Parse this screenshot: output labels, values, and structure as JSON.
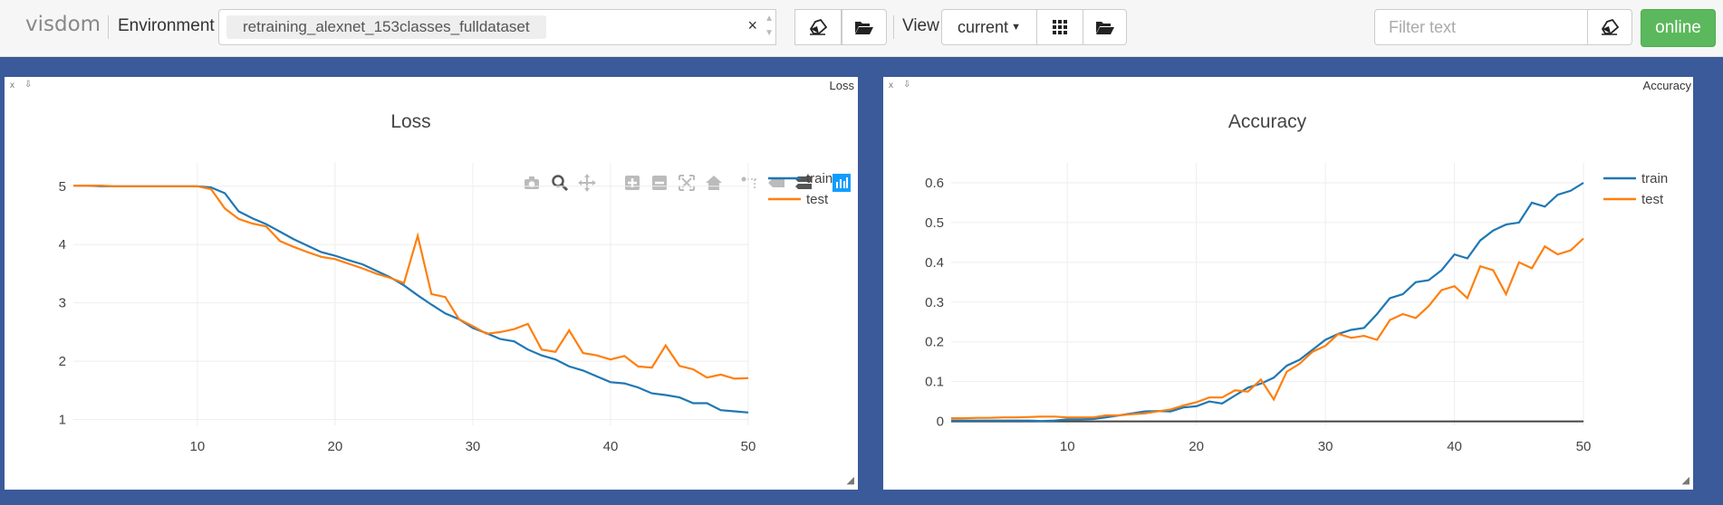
{
  "app": {
    "title": "visdom"
  },
  "env": {
    "label": "Environment",
    "selected": "retraining_alexnet_153classes_fulldataset"
  },
  "view": {
    "label": "View",
    "selected": "current"
  },
  "filter": {
    "placeholder": "Filter text"
  },
  "status": {
    "label": "online"
  },
  "colors": {
    "train": "#1f77b4",
    "test": "#ff7f0e",
    "online": "#5cb85c",
    "background": "#3b5a9a"
  },
  "panes": [
    {
      "name": "Loss",
      "title": "Loss"
    },
    {
      "name": "Accuracy",
      "title": "Accuracy"
    }
  ],
  "chart_data": [
    {
      "type": "line",
      "title": "Loss",
      "xlim": [
        1,
        50
      ],
      "ylim": [
        0.9,
        5.4
      ],
      "x_ticks": [
        10,
        20,
        30,
        40,
        50
      ],
      "y_ticks": [
        1,
        2,
        3,
        4,
        5
      ],
      "legend_position": "right",
      "grid": true,
      "x": [
        1,
        2,
        3,
        4,
        5,
        6,
        7,
        8,
        9,
        10,
        11,
        12,
        13,
        14,
        15,
        16,
        17,
        18,
        19,
        20,
        21,
        22,
        23,
        24,
        25,
        26,
        27,
        28,
        29,
        30,
        31,
        32,
        33,
        34,
        35,
        36,
        37,
        38,
        39,
        40,
        41,
        42,
        43,
        44,
        45,
        46,
        47,
        48,
        49,
        50
      ],
      "series": [
        {
          "name": "train",
          "values": [
            5.01,
            5.01,
            5.0,
            5.0,
            5.0,
            5.0,
            5.0,
            5.0,
            5.0,
            5.0,
            4.98,
            4.88,
            4.57,
            4.45,
            4.35,
            4.22,
            4.09,
            3.98,
            3.87,
            3.81,
            3.73,
            3.66,
            3.55,
            3.44,
            3.3,
            3.13,
            2.97,
            2.82,
            2.72,
            2.57,
            2.48,
            2.38,
            2.34,
            2.2,
            2.1,
            2.03,
            1.91,
            1.84,
            1.74,
            1.64,
            1.62,
            1.55,
            1.45,
            1.42,
            1.38,
            1.28,
            1.28,
            1.16,
            1.14,
            1.12
          ]
        },
        {
          "name": "test",
          "values": [
            5.01,
            5.01,
            5.01,
            5.0,
            5.0,
            5.0,
            5.0,
            5.0,
            5.0,
            5.0,
            4.95,
            4.62,
            4.44,
            4.36,
            4.31,
            4.06,
            3.96,
            3.87,
            3.79,
            3.75,
            3.67,
            3.59,
            3.5,
            3.43,
            3.34,
            4.15,
            3.15,
            3.1,
            2.72,
            2.6,
            2.47,
            2.5,
            2.55,
            2.64,
            2.2,
            2.16,
            2.53,
            2.14,
            2.1,
            2.03,
            2.09,
            1.91,
            1.89,
            2.27,
            1.92,
            1.86,
            1.72,
            1.77,
            1.7,
            1.71
          ]
        }
      ]
    },
    {
      "type": "line",
      "title": "Accuracy",
      "xlim": [
        1,
        50
      ],
      "ylim": [
        -0.01,
        0.65
      ],
      "x_ticks": [
        10,
        20,
        30,
        40,
        50
      ],
      "y_ticks": [
        0,
        0.1,
        0.2,
        0.3,
        0.4,
        0.5,
        0.6
      ],
      "legend_position": "right",
      "grid": true,
      "x": [
        1,
        2,
        3,
        4,
        5,
        6,
        7,
        8,
        9,
        10,
        11,
        12,
        13,
        14,
        15,
        16,
        17,
        18,
        19,
        20,
        21,
        22,
        23,
        24,
        25,
        26,
        27,
        28,
        29,
        30,
        31,
        32,
        33,
        34,
        35,
        36,
        37,
        38,
        39,
        40,
        41,
        42,
        43,
        44,
        45,
        46,
        47,
        48,
        49,
        50
      ],
      "series": [
        {
          "name": "train",
          "values": [
            0.002,
            0.002,
            0.002,
            0.002,
            0.002,
            0.002,
            0.002,
            0.001,
            0.002,
            0.005,
            0.005,
            0.006,
            0.01,
            0.015,
            0.02,
            0.025,
            0.026,
            0.025,
            0.035,
            0.038,
            0.05,
            0.045,
            0.065,
            0.085,
            0.095,
            0.11,
            0.14,
            0.155,
            0.18,
            0.205,
            0.22,
            0.23,
            0.235,
            0.27,
            0.31,
            0.32,
            0.35,
            0.355,
            0.38,
            0.42,
            0.41,
            0.455,
            0.48,
            0.495,
            0.5,
            0.55,
            0.54,
            0.57,
            0.58,
            0.6
          ]
        },
        {
          "name": "test",
          "values": [
            0.008,
            0.008,
            0.009,
            0.009,
            0.01,
            0.01,
            0.011,
            0.012,
            0.012,
            0.01,
            0.01,
            0.01,
            0.015,
            0.015,
            0.018,
            0.02,
            0.025,
            0.03,
            0.04,
            0.048,
            0.06,
            0.06,
            0.078,
            0.075,
            0.105,
            0.055,
            0.125,
            0.145,
            0.175,
            0.19,
            0.22,
            0.21,
            0.215,
            0.205,
            0.255,
            0.27,
            0.26,
            0.29,
            0.33,
            0.34,
            0.31,
            0.39,
            0.38,
            0.32,
            0.4,
            0.385,
            0.44,
            0.42,
            0.43,
            0.46
          ]
        }
      ]
    }
  ]
}
